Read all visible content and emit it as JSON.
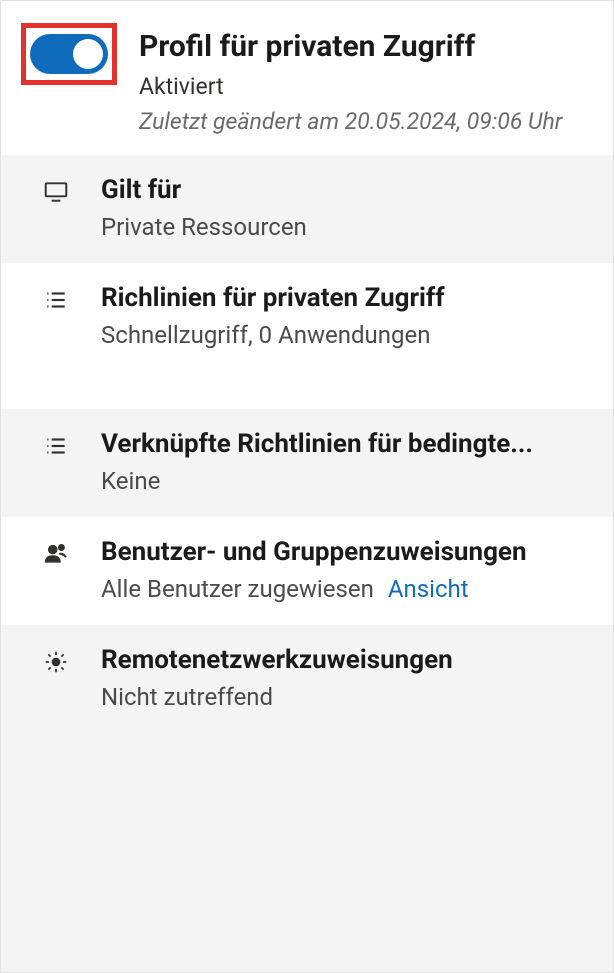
{
  "header": {
    "title": "Profil für privaten Zugriff",
    "status": "Aktiviert",
    "modified": "Zuletzt geändert am 20.05.2024, 09:06 Uhr",
    "toggle_on": true
  },
  "rows": [
    {
      "title": "Gilt für",
      "subtitle": "Private Ressourcen"
    },
    {
      "title": "Richlinien für privaten Zugriff",
      "subtitle": "Schnellzugriff, 0 Anwendungen"
    },
    {
      "title": "Verknüpfte Richtlinien für bedingte...",
      "subtitle": "Keine"
    },
    {
      "title": "Benutzer- und Gruppenzuweisungen",
      "subtitle": "Alle Benutzer zugewiesen",
      "link": "Ansicht"
    },
    {
      "title": "Remotenetzwerkzuweisungen",
      "subtitle": "Nicht zutreffend"
    }
  ]
}
